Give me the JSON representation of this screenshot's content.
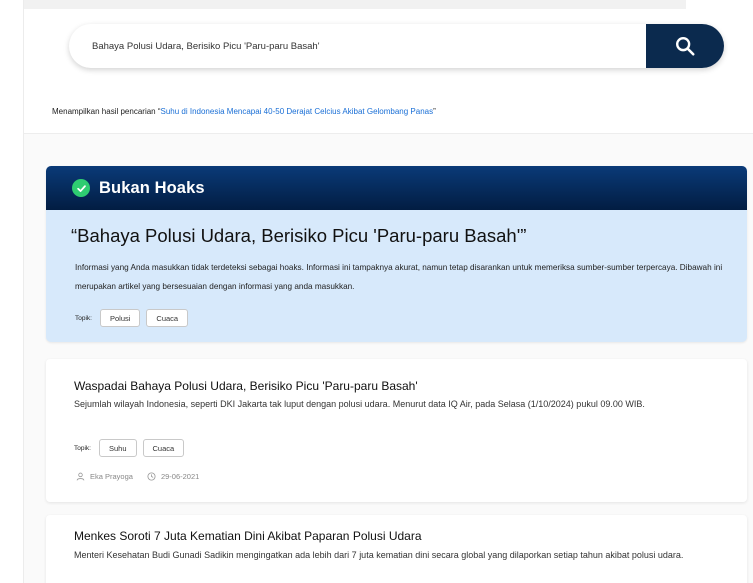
{
  "search": {
    "value": "Bahaya Polusi Udara, Berisiko Picu 'Paru-paru Basah'",
    "button_icon": "search-icon"
  },
  "result_info": {
    "prefix": "Menampilkan hasil pencarian “",
    "query": "Suhu di Indonesia Mencapai 40-50 Derajat Celcius Akibat Gelombang Panas",
    "suffix": "”"
  },
  "verdict": {
    "label": "Bukan Hoaks",
    "icon": "check-circle-icon",
    "claim": "“Bahaya Polusi Udara, Berisiko Picu 'Paru-paru Basah'”",
    "description": "Informasi yang Anda masukkan tidak terdeteksi sebagai hoaks. Informasi ini tampaknya akurat, namun tetap disarankan untuk memeriksa sumber-sumber terpercaya. Dibawah ini merupakan artikel yang bersesuaian dengan informasi yang anda masukkan.",
    "topics_label": "Topik:",
    "topics": [
      "Polusi",
      "Cuaca"
    ]
  },
  "articles": [
    {
      "title": "Waspadai Bahaya Polusi Udara, Berisiko Picu 'Paru-paru Basah'",
      "summary": "Sejumlah wilayah Indonesia, seperti DKI Jakarta tak luput dengan polusi udara. Menurut data IQ Air, pada Selasa (1/10/2024) pukul 09.00 WIB.",
      "topics_label": "Topik:",
      "topics": [
        "Suhu",
        "Cuaca"
      ],
      "author": "Eka Prayoga",
      "date": "29-06-2021"
    },
    {
      "title": "Menkes Soroti 7 Juta Kematian Dini Akibat Paparan Polusi Udara",
      "summary": "Menteri Kesehatan Budi Gunadi Sadikin mengingatkan ada lebih dari 7 juta kematian dini secara global yang dilaporkan setiap tahun akibat polusi udara."
    }
  ],
  "colors": {
    "brand_navy": "#0b2a4e",
    "verdict_bg": "#d7e9fb",
    "success_green": "#2ecc71",
    "link_blue": "#1a6fd6"
  }
}
